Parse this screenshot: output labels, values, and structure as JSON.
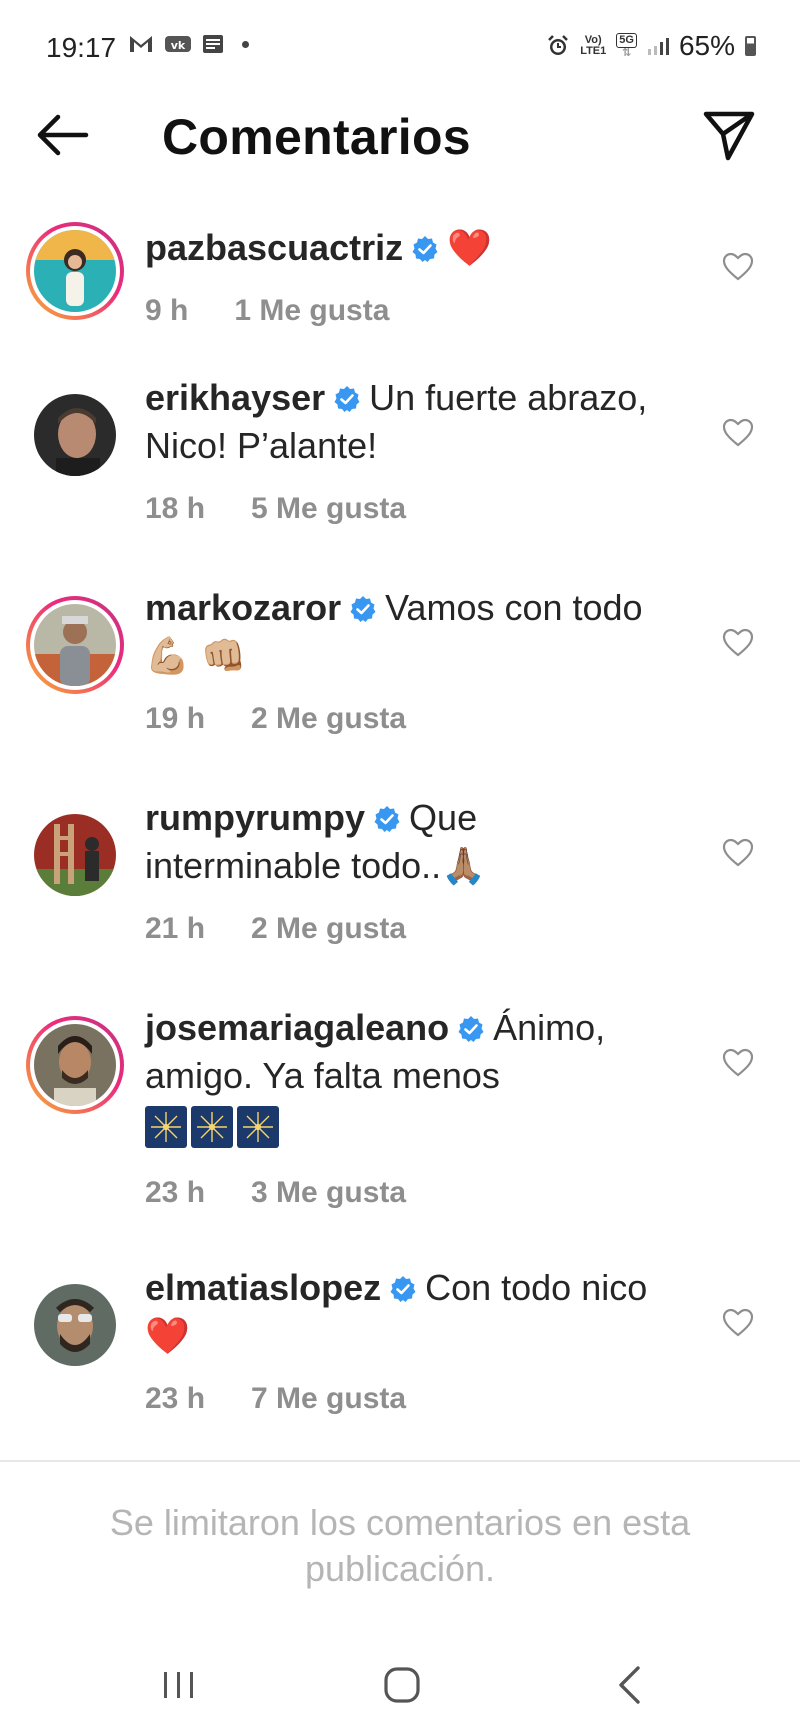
{
  "status_bar": {
    "time": "19:17",
    "left_icons": [
      "gmail-icon",
      "vk-icon",
      "message-icon"
    ],
    "net_top": "Vo)",
    "net_bottom": "LTE1",
    "network_type": "5G",
    "battery": "65%"
  },
  "header": {
    "title": "Comentarios"
  },
  "comments": [
    {
      "username": "pazbascuactriz",
      "text": "",
      "emoji": "❤️",
      "time": "9 h",
      "likes": "1 Me gusta",
      "story_ring": true,
      "avatar_color": "#f2b84b"
    },
    {
      "username": "erikhayser",
      "text": "Un fuerte abrazo, Nico! P’alante!",
      "emoji": "",
      "time": "18 h",
      "likes": "5 Me gusta",
      "story_ring": false,
      "avatar_color": "#3a3a3a"
    },
    {
      "username": "markozaror",
      "text": "Vamos con todo",
      "emoji": "💪🏼 👊🏼",
      "time": "19 h",
      "likes": "2 Me gusta",
      "story_ring": true,
      "avatar_color": "#8c8f7e"
    },
    {
      "username": "rumpyrumpy",
      "text": "Que interminable todo..",
      "emoji": "🙏🏽",
      "time": "21 h",
      "likes": "2 Me gusta",
      "story_ring": false,
      "avatar_color": "#8b3a2e"
    },
    {
      "username": "josemariagaleano",
      "text": "Ánimo, amigo. Ya falta menos",
      "emoji": "🎇🎇🎇",
      "time": "23 h",
      "likes": "3 Me gusta",
      "story_ring": true,
      "avatar_color": "#6b6151"
    },
    {
      "username": "elmatiaslopez",
      "text": "Con todo nico",
      "emoji": "❤️",
      "time": "23 h",
      "likes": "7 Me gusta",
      "story_ring": false,
      "avatar_color": "#4a4f55"
    }
  ],
  "notice": "Se limitaron los comentarios en esta publicación.",
  "colors": {
    "verified_blue": "#3897f0",
    "meta_gray": "#8e8e8e",
    "notice_gray": "#b5b5b5",
    "heart_red": "#ed2939"
  }
}
